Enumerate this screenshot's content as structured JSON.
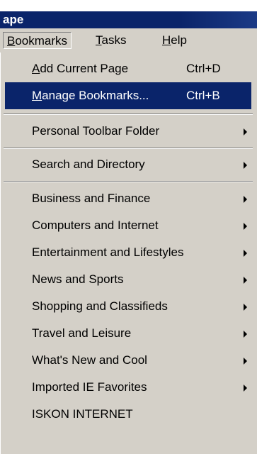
{
  "title": "ape",
  "menubar": [
    {
      "label": "Bookmarks",
      "mnemonic": "B",
      "rest": "ookmarks"
    },
    {
      "label": "Tasks",
      "mnemonic": "T",
      "rest": "asks"
    },
    {
      "label": "Help",
      "mnemonic": "H",
      "rest": "elp"
    }
  ],
  "menu": {
    "add_current_page": {
      "mnemonic": "A",
      "rest": "dd Current Page",
      "shortcut": "Ctrl+D"
    },
    "manage_bookmarks": {
      "mnemonic": "M",
      "rest": "anage Bookmarks...",
      "shortcut": "Ctrl+B"
    },
    "personal_toolbar_folder": "Personal Toolbar Folder",
    "search_and_directory": "Search and Directory",
    "folders": [
      "Business and Finance",
      "Computers and Internet",
      "Entertainment and Lifestyles",
      "News and Sports",
      "Shopping and Classifieds",
      "Travel and Leisure",
      "What's New and Cool",
      "Imported IE Favorites"
    ],
    "last_item": "ISKON INTERNET"
  }
}
